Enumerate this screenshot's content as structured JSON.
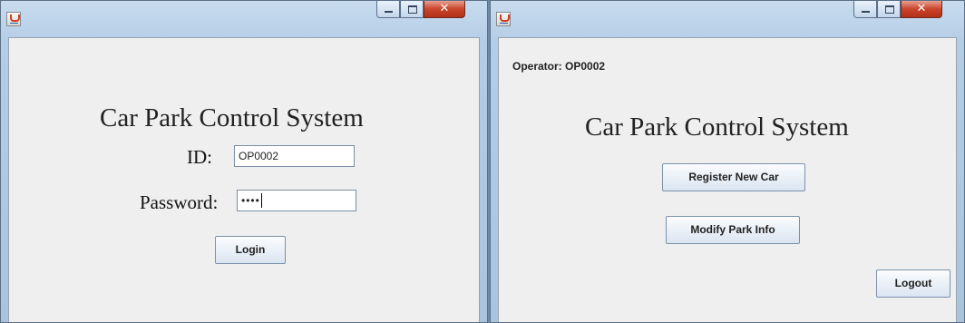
{
  "login_window": {
    "heading": "Car Park Control System",
    "id_label": "ID:",
    "id_value": "OP0002",
    "password_label": "Password:",
    "password_masked": "••••",
    "login_button": "Login",
    "controls": {
      "minimize": "minimize-icon",
      "maximize": "maximize-icon",
      "close": "close-icon"
    }
  },
  "main_window": {
    "operator_label": "Operator: OP0002",
    "heading": "Car Park Control System",
    "register_button": "Register New Car",
    "modify_button": "Modify Park Info",
    "logout_button": "Logout",
    "controls": {
      "minimize": "minimize-icon",
      "maximize": "maximize-icon",
      "close": "close-icon"
    }
  }
}
